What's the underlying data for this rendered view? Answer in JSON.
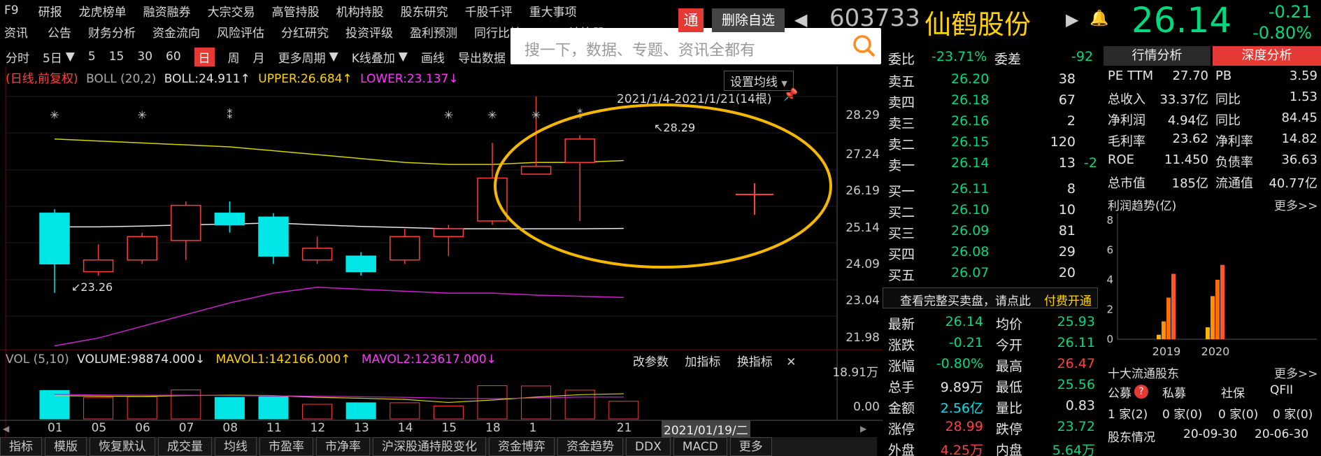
{
  "menu_row1": [
    "F9",
    "研报",
    "龙虎榜单",
    "融资融券",
    "大宗交易",
    "高管持股",
    "机构持股",
    "股东研究",
    "千股千评",
    "重大事项"
  ],
  "menu_row2": [
    "资讯",
    "公告",
    "财务分析",
    "资金流向",
    "风险评估",
    "分红研究",
    "投资评级",
    "盈利预测",
    "同行比较",
    "BETA计算器"
  ],
  "toolbar": [
    "分时",
    "5日",
    "5",
    "15",
    "30",
    "60",
    "日",
    "周",
    "月",
    "更多周期",
    "K线叠加",
    "画线",
    "导出数据"
  ],
  "toolbar_active": "日",
  "search_placeholder": "搜一下，数据、专题、资讯全都有",
  "header": {
    "tong": "通",
    "remove_watch": "删除自选",
    "code": "603733",
    "name": "仙鹤股份",
    "price": "26.14",
    "change": "-0.21",
    "change_pct": "-0.80%"
  },
  "indicator_line": {
    "period": "(日线,前复权)",
    "boll": "BOLL (20,2)",
    "boll_val": "BOLL:24.911↑",
    "upper": "UPPER:26.684↑",
    "lower": "LOWER:23.137↓"
  },
  "ma_setting": "设置均线",
  "range_label": "2021/1/4-2021/1/21(14根)",
  "high_mark": "28.29",
  "low_mark": "23.26",
  "y_axis": [
    "28.29",
    "27.24",
    "26.19",
    "25.14",
    "24.09",
    "23.04",
    "21.98"
  ],
  "vol_line": {
    "vol": "VOL (5,10)",
    "volume": "VOLUME:98874.000↓",
    "mavol1": "MAVOL1:142166.000↑",
    "mavol2": "MAVOL2:123617.000↓"
  },
  "vol_buttons": [
    "改参数",
    "加指标",
    "换指标"
  ],
  "vol_axis": [
    "18.91万",
    "0.00"
  ],
  "x_axis": [
    "01",
    "05",
    "06",
    "07",
    "08",
    "11",
    "12",
    "13",
    "14",
    "15",
    "18",
    "1",
    "21"
  ],
  "date_tooltip": "2021/01/19/二",
  "bottom_tabs": [
    "指标",
    "模版",
    "恢复默认",
    "成交量",
    "均线",
    "市盈率",
    "市净率",
    "沪深股通持股变化",
    "资金博弈",
    "资金趋势",
    "DDX",
    "MACD",
    "更多"
  ],
  "chart_data": {
    "type": "candlestick",
    "categories": [
      "01-04",
      "01-05",
      "01-06",
      "01-07",
      "01-08",
      "01-11",
      "01-12",
      "01-13",
      "01-14",
      "01-15",
      "01-18",
      "01-19",
      "01-20",
      "01-21"
    ],
    "open": [
      25.3,
      23.8,
      24.1,
      24.6,
      25.3,
      25.2,
      24.1,
      24.2,
      24.1,
      24.7,
      25.1,
      26.3,
      26.6,
      26.14
    ],
    "close": [
      24.0,
      24.1,
      24.7,
      25.5,
      25.0,
      24.2,
      24.4,
      23.8,
      24.7,
      24.9,
      26.2,
      26.5,
      27.2,
      26.14
    ],
    "high": [
      25.4,
      24.5,
      24.8,
      25.6,
      25.6,
      25.3,
      24.7,
      24.3,
      24.9,
      25.0,
      27.1,
      28.29,
      27.3,
      26.5
    ],
    "low": [
      23.26,
      23.7,
      24.0,
      24.1,
      24.8,
      24.0,
      24.0,
      23.7,
      24.0,
      24.2,
      25.0,
      26.3,
      25.1,
      25.8
    ],
    "volume_wan": [
      9.5,
      7.2,
      7.4,
      9.7,
      7.2,
      7.4,
      4.9,
      5.4,
      5.4,
      4.3,
      11.1,
      11.0,
      9.6,
      5.9
    ],
    "ylim": [
      21.98,
      28.29
    ],
    "vol_ylim": [
      0,
      18.91
    ]
  },
  "order_book": {
    "weibi_label": "委比",
    "weibi": "-23.71%",
    "weicha_label": "委差",
    "weicha": "-92",
    "sell": [
      {
        "l": "卖五",
        "p": "26.20",
        "v": "38"
      },
      {
        "l": "卖四",
        "p": "26.18",
        "v": "67"
      },
      {
        "l": "卖三",
        "p": "26.16",
        "v": "2"
      },
      {
        "l": "卖二",
        "p": "26.15",
        "v": "120"
      },
      {
        "l": "卖一",
        "p": "26.14",
        "v": "13",
        "d": "-2"
      }
    ],
    "buy": [
      {
        "l": "买一",
        "p": "26.11",
        "v": "8"
      },
      {
        "l": "买二",
        "p": "26.10",
        "v": "10"
      },
      {
        "l": "买三",
        "p": "26.09",
        "v": "81"
      },
      {
        "l": "买四",
        "p": "26.08",
        "v": "29"
      },
      {
        "l": "买五",
        "p": "26.07",
        "v": "20"
      }
    ],
    "full_text": "查看完整买卖盘，请点此",
    "full_link": "付费开通",
    "stats": [
      [
        "最新",
        "26.14",
        "均价",
        "25.93"
      ],
      [
        "涨跌",
        "-0.21",
        "今开",
        "26.11"
      ],
      [
        "涨幅",
        "-0.80%",
        "最高",
        "26.47"
      ],
      [
        "总手",
        "9.89万",
        "最低",
        "25.56"
      ],
      [
        "金额",
        "2.56亿",
        "量比",
        "0.83"
      ],
      [
        "涨停",
        "28.99",
        "跌停",
        "23.72"
      ],
      [
        "外盘",
        "4.25万",
        "内盘",
        "5.64万"
      ]
    ]
  },
  "right": {
    "tab1": "行情分析",
    "tab2": "深度分析",
    "fund": [
      [
        "PE TTM",
        "27.70",
        "PB",
        "3.59"
      ],
      [
        "总收入",
        "33.37亿",
        "同比",
        "1.53"
      ],
      [
        "净利润",
        "4.94亿",
        "同比",
        "84.45"
      ],
      [
        "毛利率",
        "23.62",
        "净利率",
        "14.82"
      ],
      [
        "ROE",
        "11.450",
        "负债率",
        "36.63"
      ],
      [
        "总市值",
        "185亿",
        "流通值",
        "40.77亿"
      ]
    ],
    "profit_title": "利润趋势(亿)",
    "more": "更多>>",
    "profit_axis": [
      "8",
      "6",
      "4",
      "2",
      "0"
    ],
    "profit_years": [
      "2019",
      "2020"
    ],
    "profit_values": [
      [
        0.3,
        1.2,
        2.8,
        4.4
      ],
      [
        0.8,
        2.9,
        4.0,
        5.0
      ]
    ],
    "holders_title": "十大流通股东",
    "holder_types": [
      "公募",
      "私募",
      "社保",
      "QFII"
    ],
    "holder_badge": "?",
    "holder_counts": [
      "1 家(2)",
      "0 家(0)",
      "0 家(0)",
      "0 家(0)"
    ],
    "holder_info": [
      "股东情况",
      "20-09-30",
      "20-06-30"
    ]
  }
}
